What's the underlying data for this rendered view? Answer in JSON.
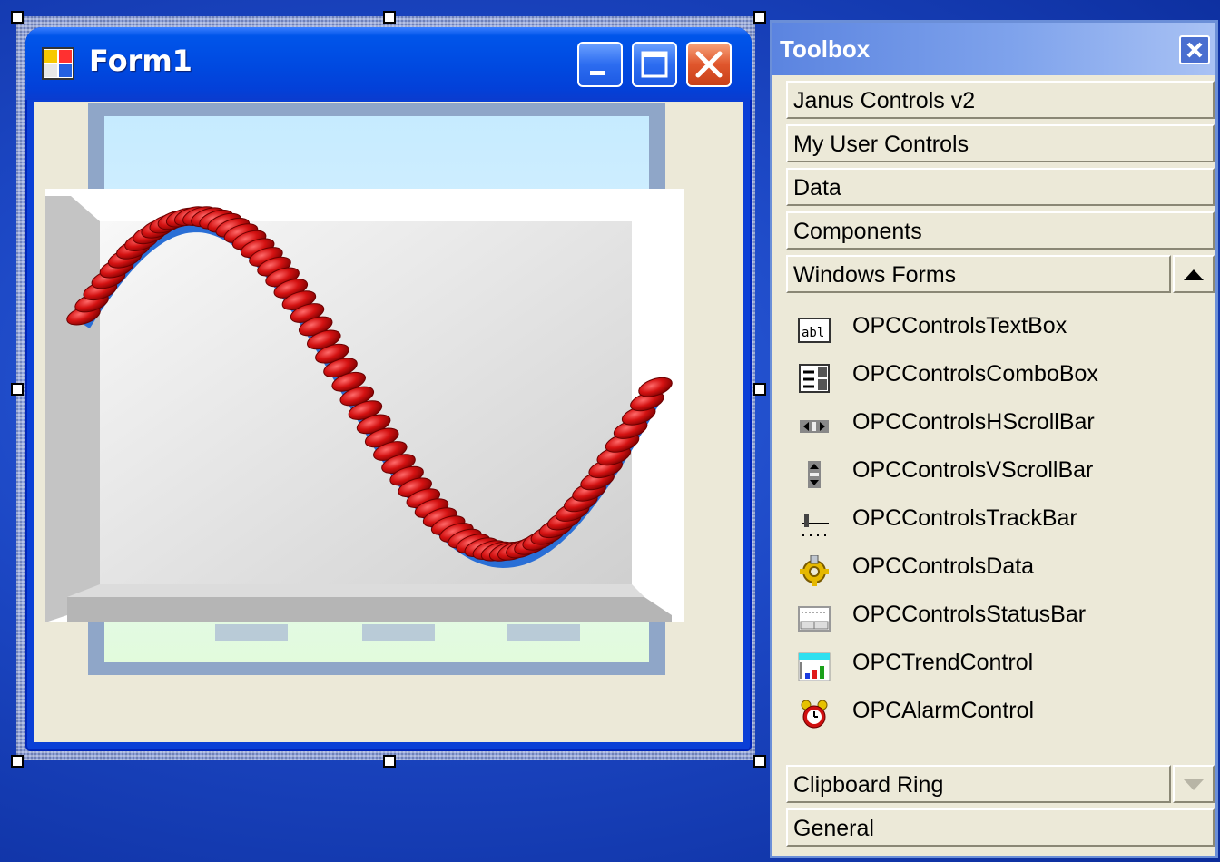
{
  "form": {
    "title": "Form1"
  },
  "toolbox": {
    "title": "Toolbox",
    "tabs_top": [
      {
        "label": "Janus Controls v2"
      },
      {
        "label": "My User Controls"
      },
      {
        "label": "Data"
      },
      {
        "label": "Components"
      },
      {
        "label": "Windows Forms"
      }
    ],
    "items": [
      {
        "label": "OPCControlsTextBox",
        "icon": "textbox-icon"
      },
      {
        "label": "OPCControlsComboBox",
        "icon": "combobox-icon"
      },
      {
        "label": "OPCControlsHScrollBar",
        "icon": "hscrollbar-icon"
      },
      {
        "label": "OPCControlsVScrollBar",
        "icon": "vscrollbar-icon"
      },
      {
        "label": "OPCControlsTrackBar",
        "icon": "trackbar-icon"
      },
      {
        "label": "OPCControlsData",
        "icon": "gear-icon"
      },
      {
        "label": "OPCControlsStatusBar",
        "icon": "statusbar-icon"
      },
      {
        "label": "OPCTrendControl",
        "icon": "trend-chart-icon"
      },
      {
        "label": "OPCAlarmControl",
        "icon": "alarm-clock-icon"
      }
    ],
    "tabs_bottom": [
      {
        "label": "Clipboard Ring"
      },
      {
        "label": "General"
      }
    ]
  },
  "colors": {
    "desktop": "#1c47c4",
    "titlebar": "#0055ea",
    "close_button": "#e0562c",
    "form_client": "#ece9d8",
    "toolbox_header": "#7fa3ec"
  }
}
